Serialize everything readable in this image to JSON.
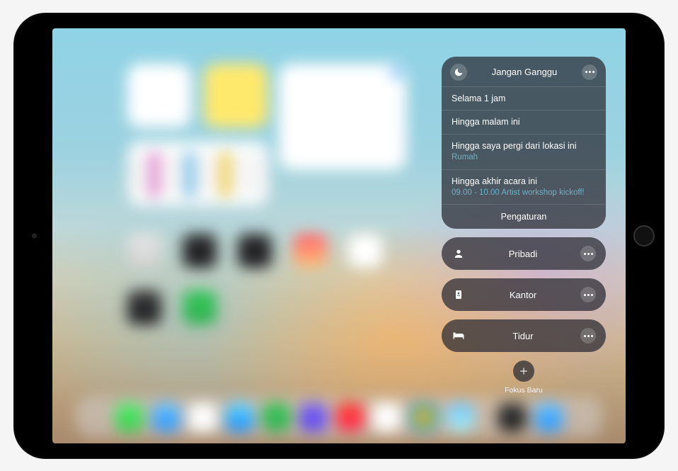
{
  "focus": {
    "active": {
      "title": "Jangan Ganggu",
      "icon": "moon-icon"
    },
    "options": [
      {
        "label": "Selama 1 jam"
      },
      {
        "label": "Hingga malam ini"
      },
      {
        "label": "Hingga saya pergi dari lokasi ini",
        "sub": "Rumah"
      },
      {
        "label": "Hingga akhir acara ini",
        "sub": "09.00 - 10.00 Artist workshop kickoff!"
      }
    ],
    "settings_label": "Pengaturan",
    "modes": [
      {
        "label": "Pribadi",
        "icon": "person-icon"
      },
      {
        "label": "Kantor",
        "icon": "badge-icon"
      },
      {
        "label": "Tidur",
        "icon": "bed-icon"
      }
    ],
    "new_focus_label": "Fokus Baru"
  }
}
